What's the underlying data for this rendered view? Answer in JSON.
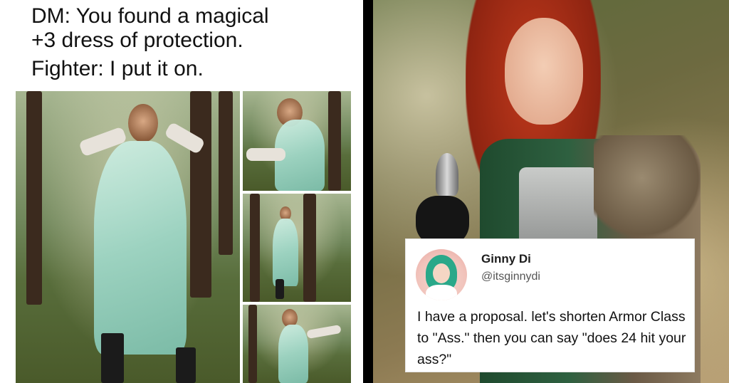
{
  "meme": {
    "caption_line1": "DM: You found a magical",
    "caption_line2": "+3 dress of protection.",
    "caption_line3": "Fighter: I put it on."
  },
  "tweet": {
    "name": "Ginny Di",
    "handle": "@itsginnydi",
    "text": "I have a proposal. let's shorten Armor Class to \"Ass.\" then you can say \"does 24 hit your ass?\""
  }
}
